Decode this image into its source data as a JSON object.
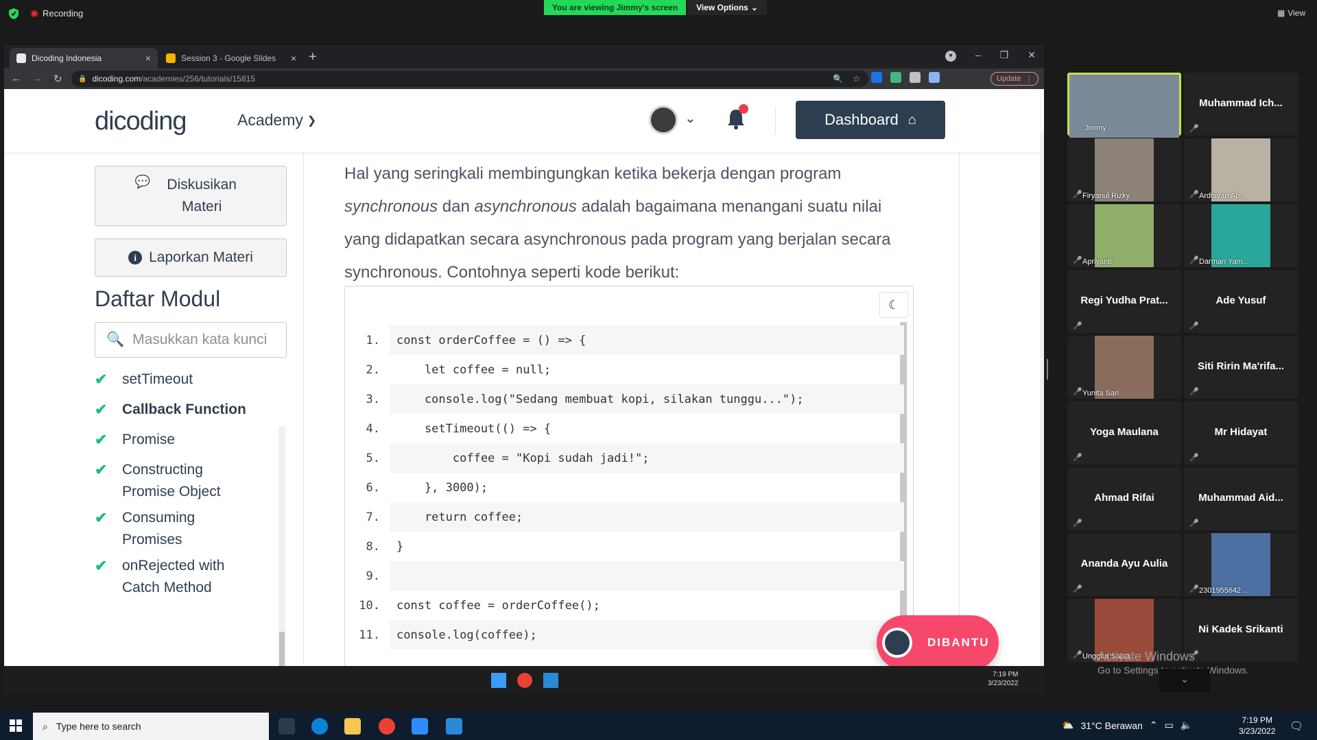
{
  "zoom": {
    "recording": "Recording",
    "viewing_banner": "You are viewing Jimmy's screen",
    "view_options": "View Options",
    "view_button": "View"
  },
  "browser": {
    "tabs": [
      {
        "label": "Dicoding Indonesia",
        "favicon_color": "#2d3e50"
      },
      {
        "label": "Session 3 - Google Slides",
        "favicon_color": "#f4b400"
      }
    ],
    "url_host": "dicoding.com",
    "url_path": "/academies/256/tutorials/15815",
    "update_label": "Update"
  },
  "site": {
    "logo": "dicoding",
    "academy": "Academy",
    "dashboard": "Dashboard",
    "sidebar": {
      "discuss": "Diskusikan Materi",
      "report": "Laporkan Materi",
      "modules_title": "Daftar Modul",
      "search_placeholder": "Masukkan kata kunci",
      "modules": [
        {
          "label": "setTimeout"
        },
        {
          "label": "Callback Function",
          "active": true
        },
        {
          "label": "Promise"
        },
        {
          "label": "Constructing Promise Object"
        },
        {
          "label": "Consuming Promises"
        },
        {
          "label": "onRejected with Catch Method"
        }
      ]
    },
    "paragraph_1": "Hal yang seringkali membingungkan ketika bekerja dengan program",
    "paragraph_em1": "synchronous",
    "paragraph_2": " dan ",
    "paragraph_em2": "asynchronous",
    "paragraph_3": " adalah bagaimana menangani suatu nilai yang didapatkan secara asynchronous pada program yang berjalan secara synchronous. Contohnya seperti kode berikut:",
    "code_lines": [
      {
        "n": "1.",
        "text": "const orderCoffee = () => {"
      },
      {
        "n": "2.",
        "text": "    let coffee = null;"
      },
      {
        "n": "3.",
        "text": "    console.log(\"Sedang membuat kopi, silakan tunggu...\");"
      },
      {
        "n": "4.",
        "text": "    setTimeout(() => {"
      },
      {
        "n": "5.",
        "text": "        coffee = \"Kopi sudah jadi!\";"
      },
      {
        "n": "6.",
        "text": "    }, 3000);"
      },
      {
        "n": "7.",
        "text": "    return coffee;"
      },
      {
        "n": "8.",
        "text": "}"
      },
      {
        "n": "9.",
        "text": ""
      },
      {
        "n": "10.",
        "text": "const coffee = orderCoffee();"
      },
      {
        "n": "11.",
        "text": "console.log(coffee);"
      }
    ],
    "dibantu": "DIBANTU"
  },
  "shared_clock": {
    "time": "7:19 PM",
    "date": "3/23/2022"
  },
  "participants": [
    {
      "name": "Jimmy",
      "video": true,
      "color": "#7a8a99"
    },
    {
      "name": "Muhammad Ich...",
      "video": false
    },
    {
      "name": "Firyanul Rizky",
      "video": true,
      "color": "#8d8378"
    },
    {
      "name": "Ardhiyan Ab...",
      "video": true,
      "color": "#b9b2a4"
    },
    {
      "name": "Apriyanti",
      "video": true,
      "color": "#8fae6a"
    },
    {
      "name": "Darman Yam...",
      "video": true,
      "color": "#2aa79b"
    },
    {
      "name": "Regi Yudha Prat...",
      "video": false
    },
    {
      "name": "Ade Yusuf",
      "video": false
    },
    {
      "name": "Yunita Sari",
      "video": true,
      "color": "#8a6c5c"
    },
    {
      "name": "Siti Ririn Ma'rifa...",
      "video": false
    },
    {
      "name": "Yoga Maulana",
      "video": false
    },
    {
      "name": "Mr Hidayat",
      "video": false
    },
    {
      "name": "Ahmad Rifai",
      "video": false
    },
    {
      "name": "Muhammad Aid...",
      "video": false
    },
    {
      "name": "Ananda Ayu Aulia",
      "video": false
    },
    {
      "name": "2301955642 ...",
      "video": true,
      "color": "#4a6fa0"
    },
    {
      "name": "Unggari Salsa...",
      "video": true,
      "color": "#9a4a3a"
    },
    {
      "name": "Ni Kadek Srikanti",
      "video": false
    }
  ],
  "windows_activation": {
    "title": "Activate Windows",
    "subtitle": "Go to Settings to activate Windows."
  },
  "taskbar": {
    "search_placeholder": "Type here to search",
    "weather": "31°C  Berawan",
    "time": "7:19 PM",
    "date": "3/23/2022"
  }
}
